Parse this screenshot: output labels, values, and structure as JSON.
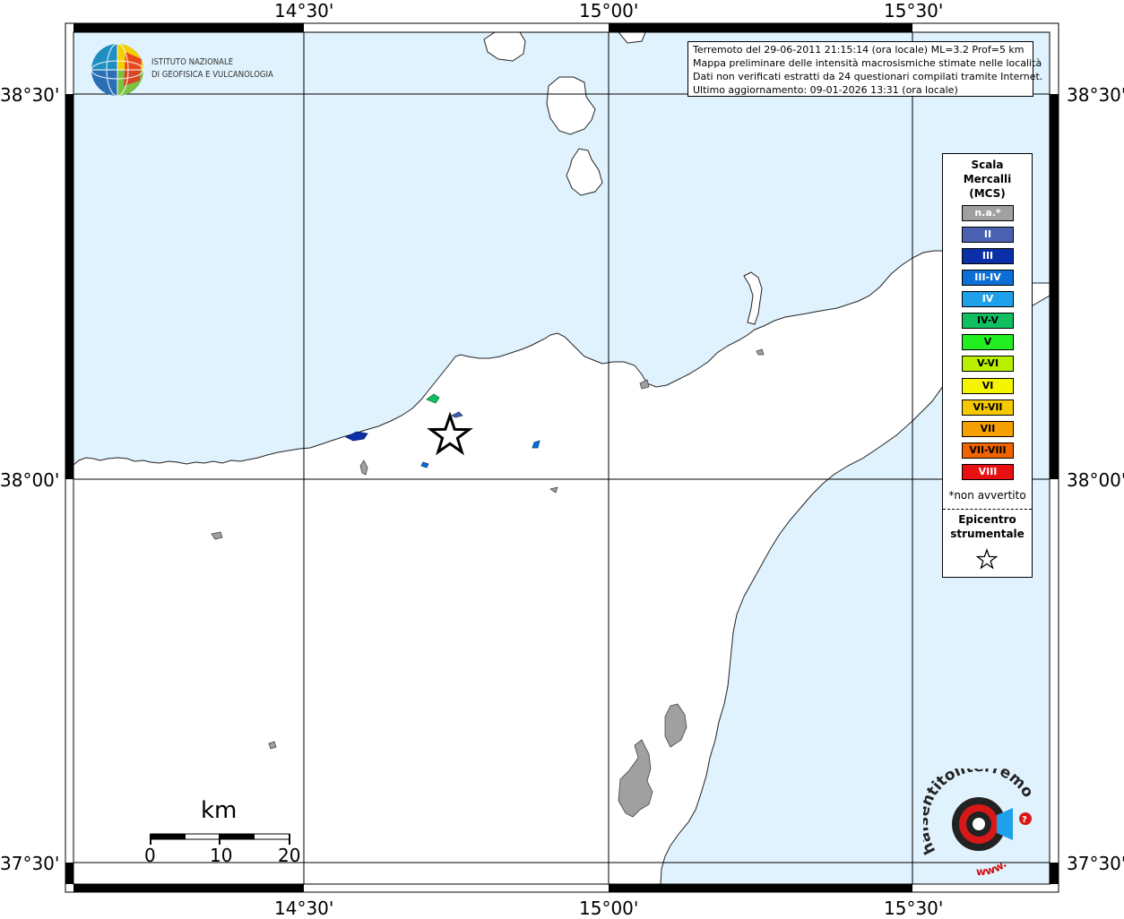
{
  "graticule": {
    "lon_labels": [
      "14°30'",
      "15°00'",
      "15°30'"
    ],
    "lat_labels": [
      "38°30'",
      "38°00'",
      "37°30'"
    ]
  },
  "institute": {
    "line1": "ISTITUTO NAZIONALE",
    "line2": "DI GEOFISICA E VULCANOLOGIA"
  },
  "info_box": {
    "line1": "Terremoto del 29-06-2011 21:15:14 (ora locale) ML=3.2 Prof=5 km",
    "line2": "Mappa preliminare delle intensità macrosismiche stimate nelle località",
    "line3": "Dati non verificati estratti da 24 questionari compilati tramite Internet.",
    "line4": "Ultimo aggiornamento: 09-01-2026 13:31 (ora locale)"
  },
  "legend": {
    "title_line1": "Scala",
    "title_line2": "Mercalli",
    "title_line3": "(MCS)",
    "classes": [
      {
        "label": "n.a.*",
        "color": "#a0a0a0"
      },
      {
        "label": "II",
        "color": "#4a60b0"
      },
      {
        "label": "III",
        "color": "#0b2fa8"
      },
      {
        "label": "III-IV",
        "color": "#0a6fd6"
      },
      {
        "label": "IV",
        "color": "#1ea0ea"
      },
      {
        "label": "IV-V",
        "color": "#10c060"
      },
      {
        "label": "V",
        "color": "#22ee22"
      },
      {
        "label": "V-VI",
        "color": "#b8f000"
      },
      {
        "label": "VI",
        "color": "#f5f500"
      },
      {
        "label": "VI-VII",
        "color": "#f5c800"
      },
      {
        "label": "VII",
        "color": "#f5a000"
      },
      {
        "label": "VII-VIII",
        "color": "#f06400"
      },
      {
        "label": "VIII",
        "color": "#e81010"
      }
    ],
    "not_felt_note": "*non avvertito",
    "epicenter_line1": "Epicentro",
    "epicenter_line2": "strumentale"
  },
  "scale_bar": {
    "unit": "km",
    "ticks": [
      "0",
      "10",
      "20"
    ]
  },
  "brand": {
    "text_main": "haisentitoilterremoto.it",
    "text_prefix": "www."
  },
  "colors": {
    "sea": "#e0f2fd",
    "land": "#ffffff",
    "frame": "#000000",
    "intensity_II": "#4a60b0",
    "intensity_III": "#0b2fa8",
    "intensity_III_IV": "#0a6fd6",
    "intensity_IV_V": "#10c060",
    "intensity_na": "#a0a0a0"
  }
}
